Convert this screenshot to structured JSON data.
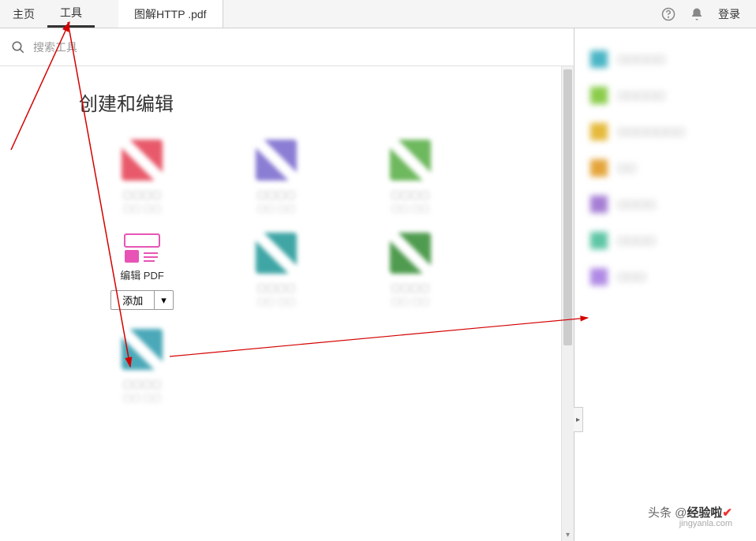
{
  "tabs": {
    "home": "主页",
    "tools": "工具",
    "document": "图解HTTP .pdf"
  },
  "header": {
    "login": "登录"
  },
  "search": {
    "placeholder": "搜索工具"
  },
  "section": {
    "title": "创建和编辑"
  },
  "tools_grid": [
    {
      "label": "",
      "blurred": true,
      "color": "c-red"
    },
    {
      "label": "",
      "blurred": true,
      "color": "c-purple"
    },
    {
      "label": "",
      "blurred": true,
      "color": "c-green"
    },
    {
      "label": "编辑 PDF",
      "blurred": false,
      "color": "edit-pdf"
    },
    {
      "label": "",
      "blurred": true,
      "color": "c-teal"
    },
    {
      "label": "",
      "blurred": true,
      "color": "c-green2"
    },
    {
      "label": "",
      "blurred": true,
      "color": "c-cyan"
    }
  ],
  "add_button": {
    "label": "添加"
  },
  "sidebar_items": [
    {
      "color": "sc-teal"
    },
    {
      "color": "sc-green"
    },
    {
      "color": "sc-yellow"
    },
    {
      "color": "sc-orange"
    },
    {
      "color": "sc-purple"
    },
    {
      "color": "sc-mint"
    },
    {
      "color": "sc-violet"
    }
  ],
  "watermark": {
    "prefix": "头条 @",
    "bold": "经验啦",
    "url": "jingyanla.com"
  }
}
